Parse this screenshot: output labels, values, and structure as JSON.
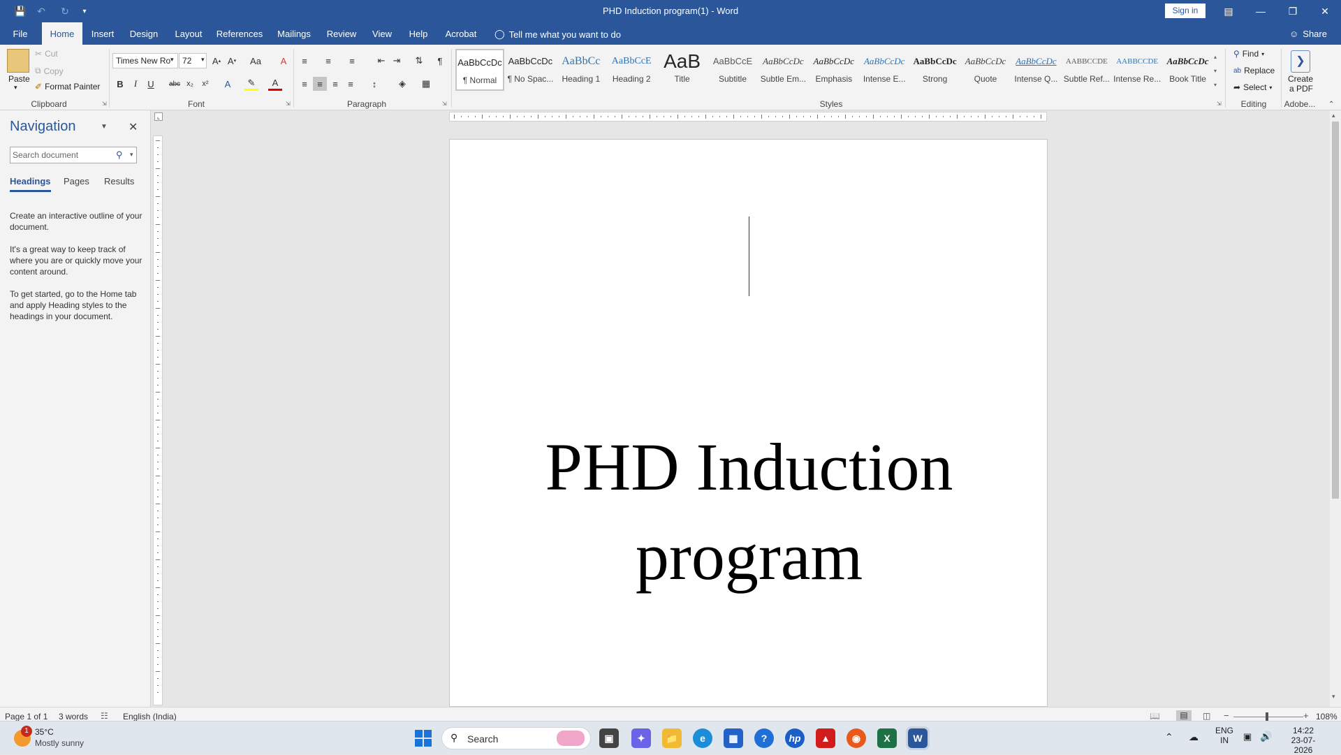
{
  "titlebar": {
    "doc_title": "PHD Induction program(1)  -  Word",
    "signin": "Sign in"
  },
  "tabs": [
    "File",
    "Home",
    "Insert",
    "Design",
    "Layout",
    "References",
    "Mailings",
    "Review",
    "View",
    "Help",
    "Acrobat"
  ],
  "tellme": "Tell me what you want to do",
  "share": "Share",
  "clipboard": {
    "paste": "Paste",
    "cut": "Cut",
    "copy": "Copy",
    "format_painter": "Format Painter",
    "label": "Clipboard"
  },
  "font": {
    "name": "Times New Ro",
    "size": "72",
    "label": "Font",
    "case": "Aa"
  },
  "paragraph": {
    "label": "Paragraph"
  },
  "styles": {
    "label": "Styles",
    "items": [
      {
        "preview": "AaBbCcDc",
        "name": "¶ Normal"
      },
      {
        "preview": "AaBbCcDc",
        "name": "¶ No Spac..."
      },
      {
        "preview": "AaBbCc",
        "name": "Heading 1"
      },
      {
        "preview": "AaBbCcE",
        "name": "Heading 2"
      },
      {
        "preview": "AaB",
        "name": "Title"
      },
      {
        "preview": "AaBbCcE",
        "name": "Subtitle"
      },
      {
        "preview": "AaBbCcDc",
        "name": "Subtle Em..."
      },
      {
        "preview": "AaBbCcDc",
        "name": "Emphasis"
      },
      {
        "preview": "AaBbCcDc",
        "name": "Intense E..."
      },
      {
        "preview": "AaBbCcDc",
        "name": "Strong"
      },
      {
        "preview": "AaBbCcDc",
        "name": "Quote"
      },
      {
        "preview": "AaBbCcDc",
        "name": "Intense Q..."
      },
      {
        "preview": "AABBCCDE",
        "name": "Subtle Ref..."
      },
      {
        "preview": "AABBCCDE",
        "name": "Intense Re..."
      },
      {
        "preview": "AaBbCcDc",
        "name": "Book Title"
      }
    ]
  },
  "editing": {
    "find": "Find",
    "replace": "Replace",
    "select": "Select",
    "label": "Editing"
  },
  "adobe": {
    "create_pdf_1": "Create",
    "create_pdf_2": "a PDF",
    "label": "Adobe..."
  },
  "navigation": {
    "title": "Navigation",
    "search_placeholder": "Search document",
    "tabs": [
      "Headings",
      "Pages",
      "Results"
    ],
    "text1": "Create an interactive outline of your document.",
    "text2": "It's a great way to keep track of where you are or quickly move your content around.",
    "text3": "To get started, go to the Home tab and apply Heading styles to the headings in your document."
  },
  "document": {
    "heading_line1": "PHD Induction",
    "heading_line2": "program"
  },
  "status": {
    "page": "Page 1 of 1",
    "words": "3 words",
    "language": "English (India)",
    "zoom": "108%"
  },
  "taskbar": {
    "weather_temp": "35°C",
    "weather_desc": "Mostly sunny",
    "weather_badge": "1",
    "search": "Search",
    "lang1": "ENG",
    "lang2": "IN",
    "time": "14:22",
    "date": "23-07-2026"
  },
  "colors": {
    "accent": "#2b579a",
    "ribbon": "#f3f3f3",
    "taskbar": "#dfe6ee"
  }
}
